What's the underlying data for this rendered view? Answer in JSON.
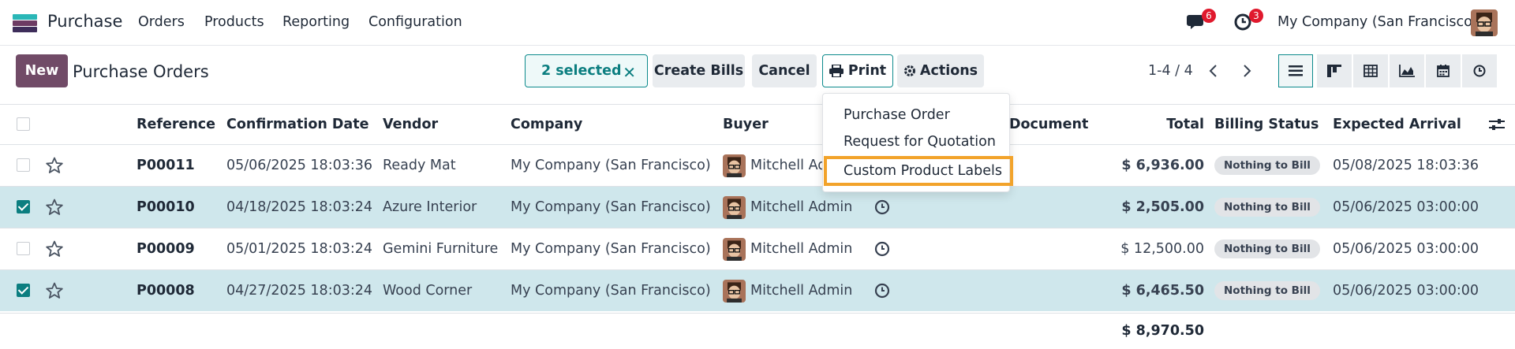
{
  "navbar": {
    "app_name": "Purchase",
    "menu": [
      "Orders",
      "Products",
      "Reporting",
      "Configuration"
    ],
    "messages_badge": "6",
    "activities_badge": "3",
    "company": "My Company (San Francisco)"
  },
  "control": {
    "new_label": "New",
    "title": "Purchase Orders",
    "selected_label": "2 selected",
    "create_bills_label": "Create Bills",
    "cancel_label": "Cancel",
    "print_label": "Print",
    "actions_label": "Actions",
    "pager": "1-4 / 4"
  },
  "print_menu": {
    "items": [
      "Purchase Order",
      "Request for Quotation",
      "Custom Product Labels"
    ],
    "highlighted_index": 2
  },
  "table": {
    "columns": [
      "Reference",
      "Confirmation Date",
      "Vendor",
      "Company",
      "Buyer",
      "Document",
      "Total",
      "Billing Status",
      "Expected Arrival"
    ],
    "rows": [
      {
        "ref": "P00011",
        "date": "05/06/2025 18:03:36",
        "vendor": "Ready Mat",
        "company": "My Company (San Francisco)",
        "buyer": "Mitchell Admin",
        "total": "$ 6,936.00",
        "billing": "Nothing to Bill",
        "arrival": "05/08/2025 18:03:36",
        "selected": false
      },
      {
        "ref": "P00010",
        "date": "04/18/2025 18:03:24",
        "vendor": "Azure Interior",
        "company": "My Company (San Francisco)",
        "buyer": "Mitchell Admin",
        "total": "$ 2,505.00",
        "billing": "Nothing to Bill",
        "arrival": "05/06/2025 03:00:00",
        "selected": true
      },
      {
        "ref": "P00009",
        "date": "05/01/2025 18:03:24",
        "vendor": "Gemini Furniture",
        "company": "My Company (San Francisco)",
        "buyer": "Mitchell Admin",
        "total": "$ 12,500.00",
        "billing": "Nothing to Bill",
        "arrival": "05/06/2025 03:00:00",
        "selected": false
      },
      {
        "ref": "P00008",
        "date": "04/27/2025 18:03:24",
        "vendor": "Wood Corner",
        "company": "My Company (San Francisco)",
        "buyer": "Mitchell Admin",
        "total": "$ 6,465.50",
        "billing": "Nothing to Bill",
        "arrival": "05/06/2025 03:00:00",
        "selected": true
      }
    ],
    "footer_total": "$ 8,970.50"
  },
  "colors": {
    "brand": "#714b67",
    "accent": "#0c8a8c",
    "selected_row": "#cfe7ec",
    "highlight_border": "#f2a32b",
    "badge_red": "#e0192d"
  },
  "icons": [
    "app-logo-icon",
    "chat-icon",
    "clock-icon",
    "print-icon",
    "gear-icon",
    "chevron-left-icon",
    "chevron-right-icon",
    "list-view-icon",
    "kanban-view-icon",
    "pivot-view-icon",
    "graph-view-icon",
    "calendar-view-icon",
    "activity-view-icon",
    "star-icon",
    "optional-columns-icon"
  ]
}
